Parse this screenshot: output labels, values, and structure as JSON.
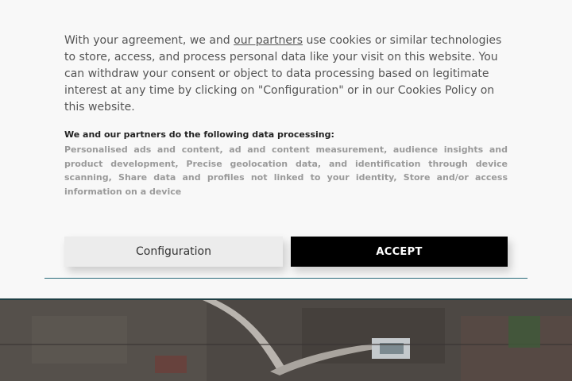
{
  "consent": {
    "text_before_link": "With your agreement, we and ",
    "partners_link": "our partners",
    "text_after_link": " use cookies or similar technologies to store, access, and process personal data like your visit on this website. You can withdraw your consent or object to data processing based on legitimate interest at any time by clicking on \"Configuration\" or in our Cookies Policy on this website.",
    "processing_heading": "We and our partners do the following data processing:",
    "processing_list": "Personalised ads and content, ad and content measurement, audience insights and product development, Precise geolocation data, and identification through device scanning, Share data and profiles not linked to your identity, Store and/or access information on a device",
    "configuration_label": "Configuration",
    "accept_label": "ACCEPT"
  },
  "colors": {
    "panel_background": "#f8f8f8",
    "accept_background": "#000000",
    "configuration_background": "#ececec",
    "divider": "#2a6b7a"
  }
}
